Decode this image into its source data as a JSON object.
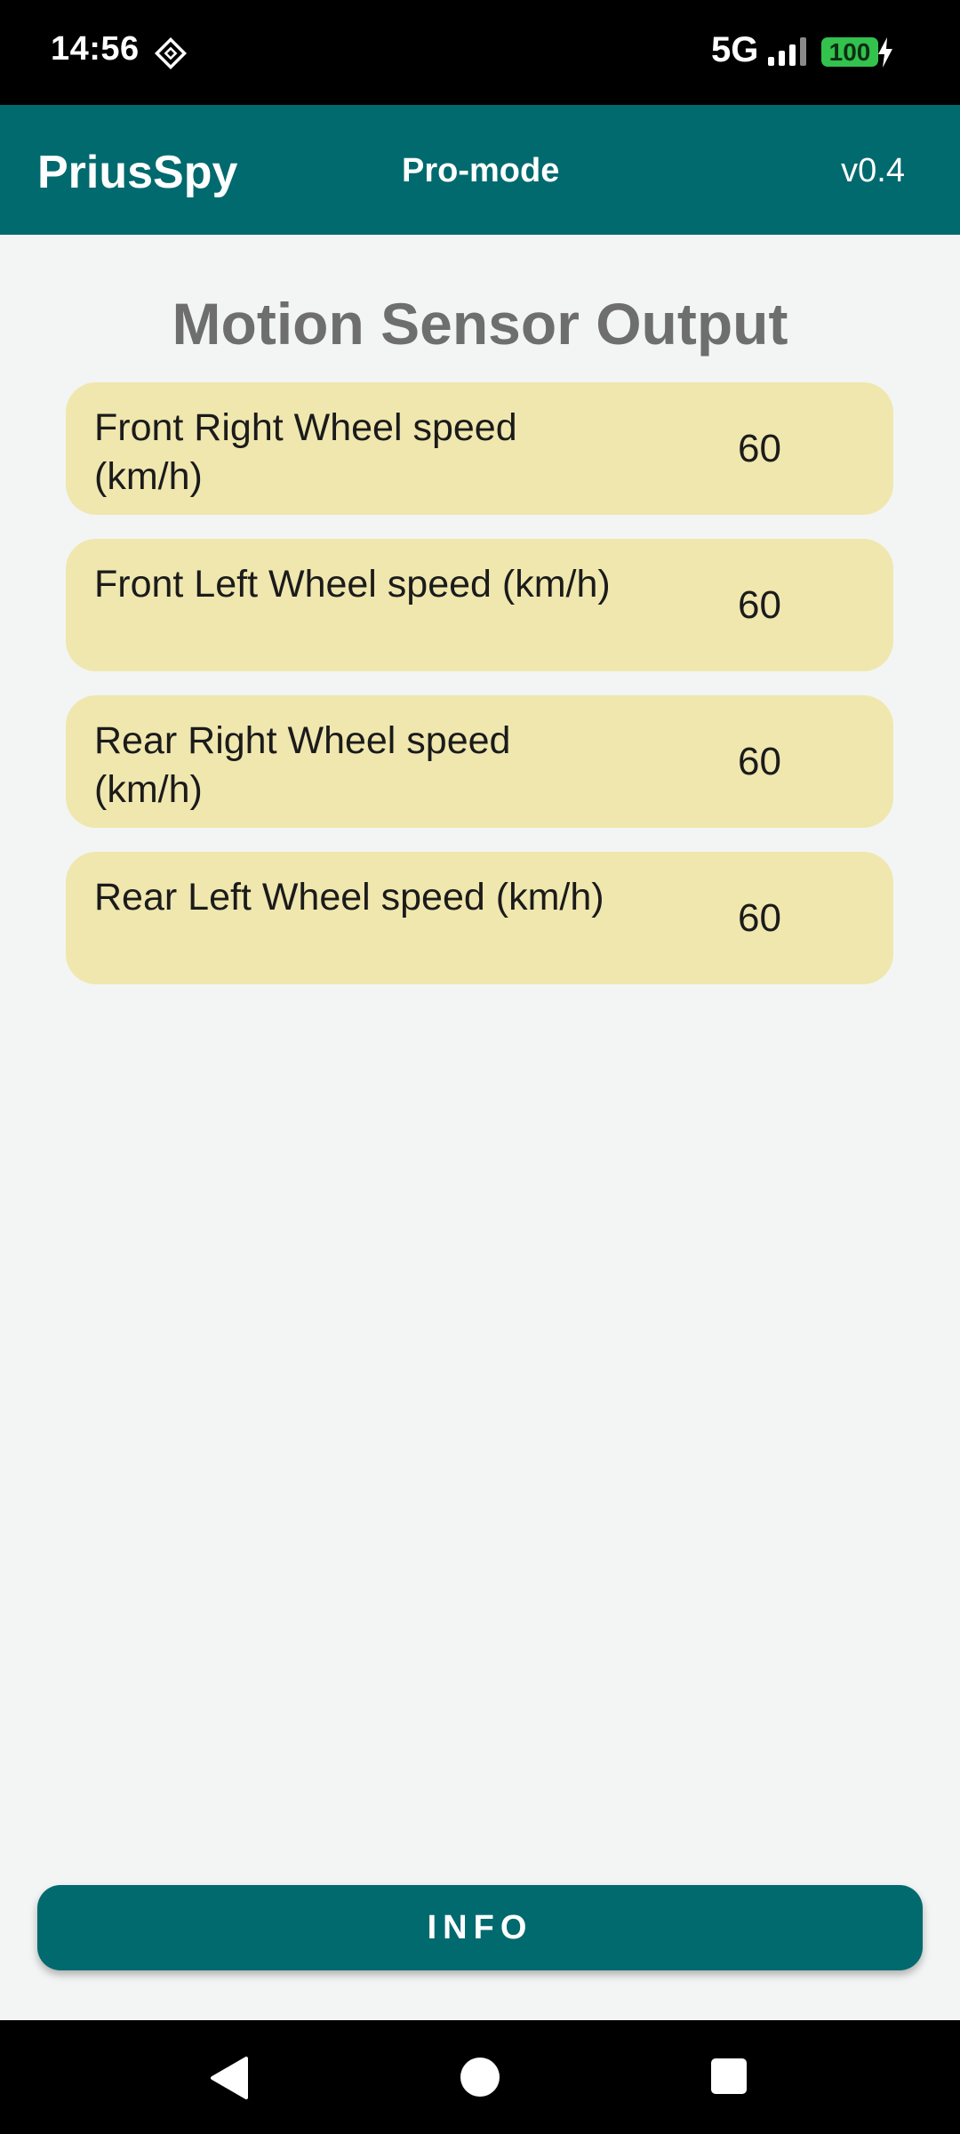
{
  "status_bar": {
    "time": "14:56",
    "network": "5G",
    "battery": "100",
    "icons": [
      "notification-diamond-icon",
      "signal-icon",
      "charging-icon"
    ]
  },
  "app_bar": {
    "title": "PriusSpy",
    "mode": "Pro-mode",
    "version": "v0.4"
  },
  "main": {
    "title": "Motion Sensor Output",
    "sensors": [
      {
        "label": "Front Right Wheel speed (km/h)",
        "value": "60"
      },
      {
        "label": "Front Left Wheel speed (km/h)",
        "value": "60"
      },
      {
        "label": "Rear Right Wheel speed (km/h)",
        "value": "60"
      },
      {
        "label": "Rear Left Wheel speed (km/h)",
        "value": "60"
      }
    ]
  },
  "info_button": {
    "label": "INFO"
  },
  "nav_bar": {
    "icons": [
      "back-icon",
      "home-icon",
      "recents-icon"
    ]
  },
  "colors": {
    "app_bar": "#006a6f",
    "card": "#efe7ae",
    "background": "#f3f5f4",
    "title_text": "#6e6e6e",
    "battery": "#32c24d"
  }
}
